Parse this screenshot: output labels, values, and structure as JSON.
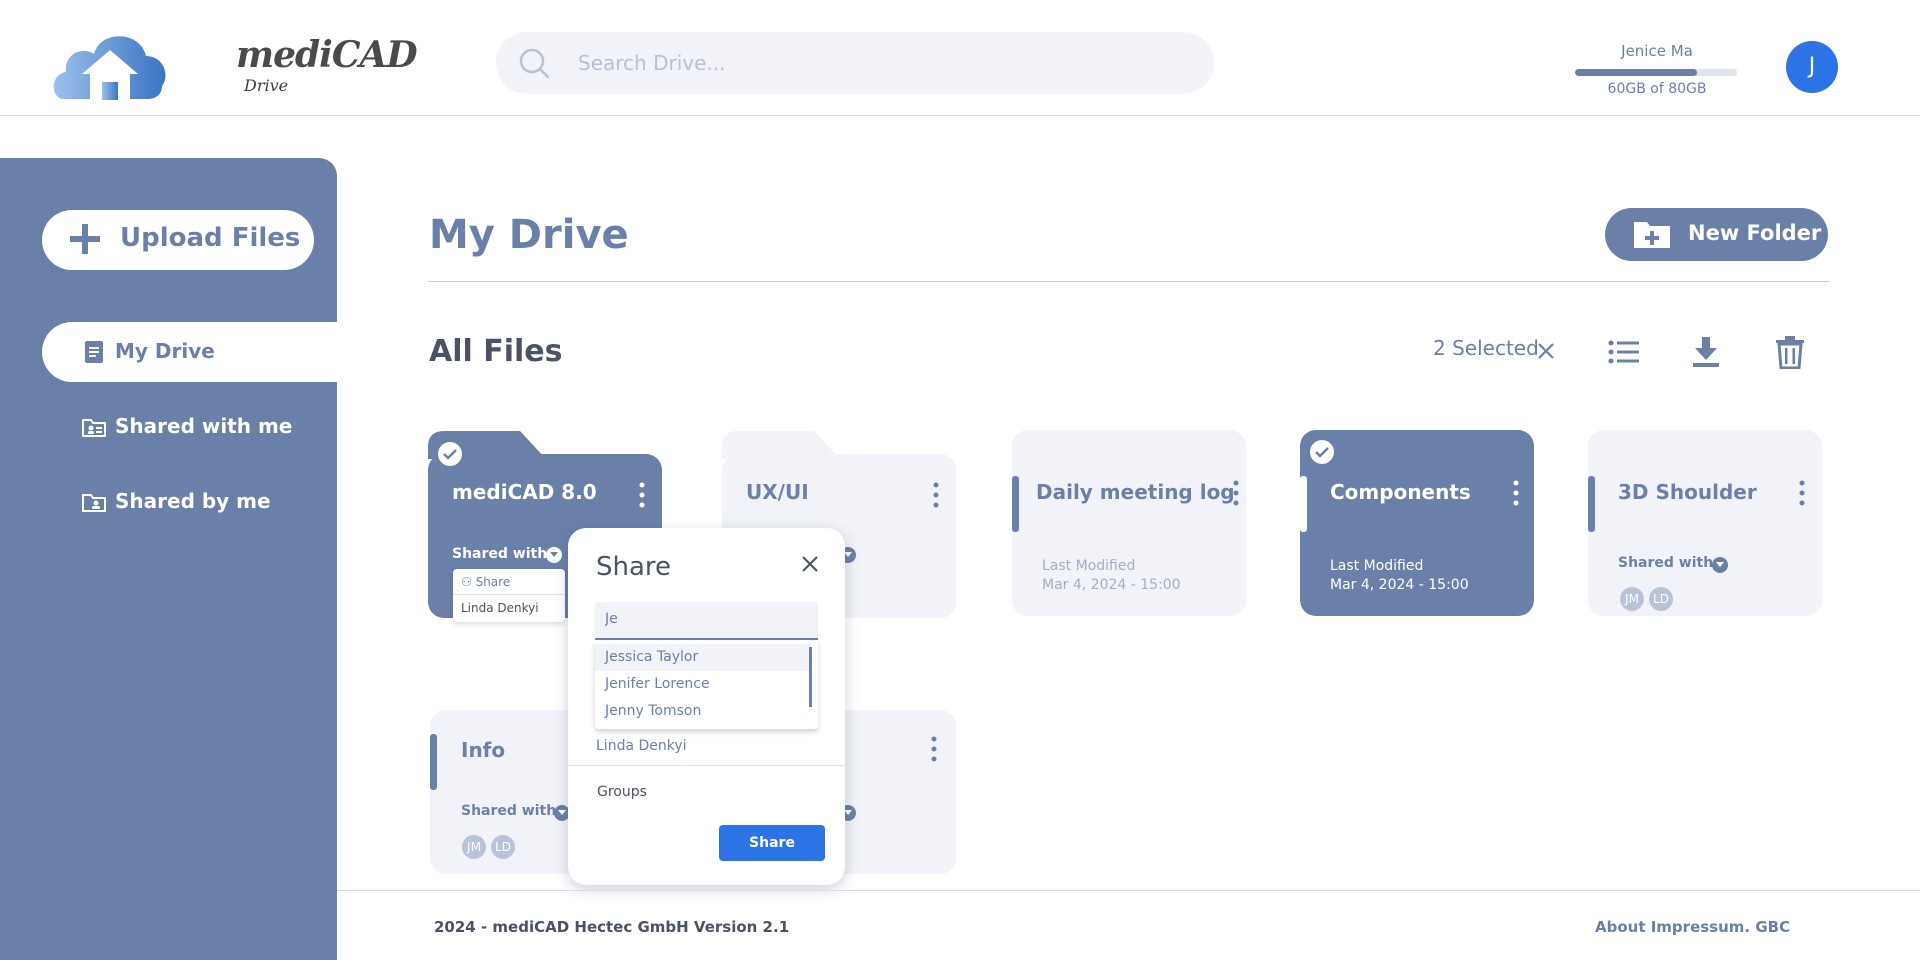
{
  "app": {
    "logo_word": "mediCAD",
    "logo_sub": "Drive"
  },
  "search": {
    "placeholder": "Search Drive..."
  },
  "user": {
    "name": "Jenice Ma",
    "initial": "J",
    "storage_text": "60GB of 80GB",
    "storage_fraction": 0.75
  },
  "sidebar": {
    "upload_label": "Upload Files",
    "items": [
      {
        "label": "My Drive",
        "icon": "document-icon",
        "active": true
      },
      {
        "label": "Shared with me",
        "icon": "folder-shared-icon",
        "active": false
      },
      {
        "label": "Shared by me",
        "icon": "folder-user-icon",
        "active": false
      }
    ]
  },
  "main": {
    "title": "My Drive",
    "new_folder_label": "New Folder",
    "section_title": "All Files",
    "selected_text": "2 Selected"
  },
  "cards": [
    {
      "title": "mediCAD 8.0",
      "type": "folder",
      "selected": true,
      "shared_label": "Shared with"
    },
    {
      "title": "UX/UI",
      "type": "folder",
      "selected": false
    },
    {
      "title": "Daily meeting log",
      "type": "file",
      "selected": false,
      "meta_label": "Last Modified",
      "meta_date": "Mar 4, 2024 - 15:00"
    },
    {
      "title": "Components",
      "type": "file",
      "selected": true,
      "meta_label": "Last Modified",
      "meta_date": "Mar 4, 2024 - 15:00"
    },
    {
      "title": "3D Shoulder",
      "type": "file",
      "selected": false,
      "shared_label": "Shared with",
      "chips": [
        "JM",
        "LD"
      ]
    },
    {
      "title": "Info",
      "type": "file",
      "selected": false,
      "shared_label": "Shared with",
      "chips": [
        "JM",
        "LD"
      ]
    }
  ],
  "mini_menu": {
    "action": "Share",
    "person": "Linda Denkyi"
  },
  "share_modal": {
    "title": "Share",
    "input_value": "Je",
    "suggestions": [
      "Jessica Taylor",
      "Jenifer Lorence",
      "Jenny Tomson"
    ],
    "person": "Linda Denkyi",
    "groups_label": "Groups",
    "button_label": "Share"
  },
  "footer": {
    "left": "2024 - mediCAD Hectec GmbH Version 2.1",
    "right": "About Impressum. GBC"
  },
  "colors": {
    "primary": "#6b80a8",
    "accent_blue": "#2c73e6",
    "card_bg": "#f1f3f8"
  }
}
